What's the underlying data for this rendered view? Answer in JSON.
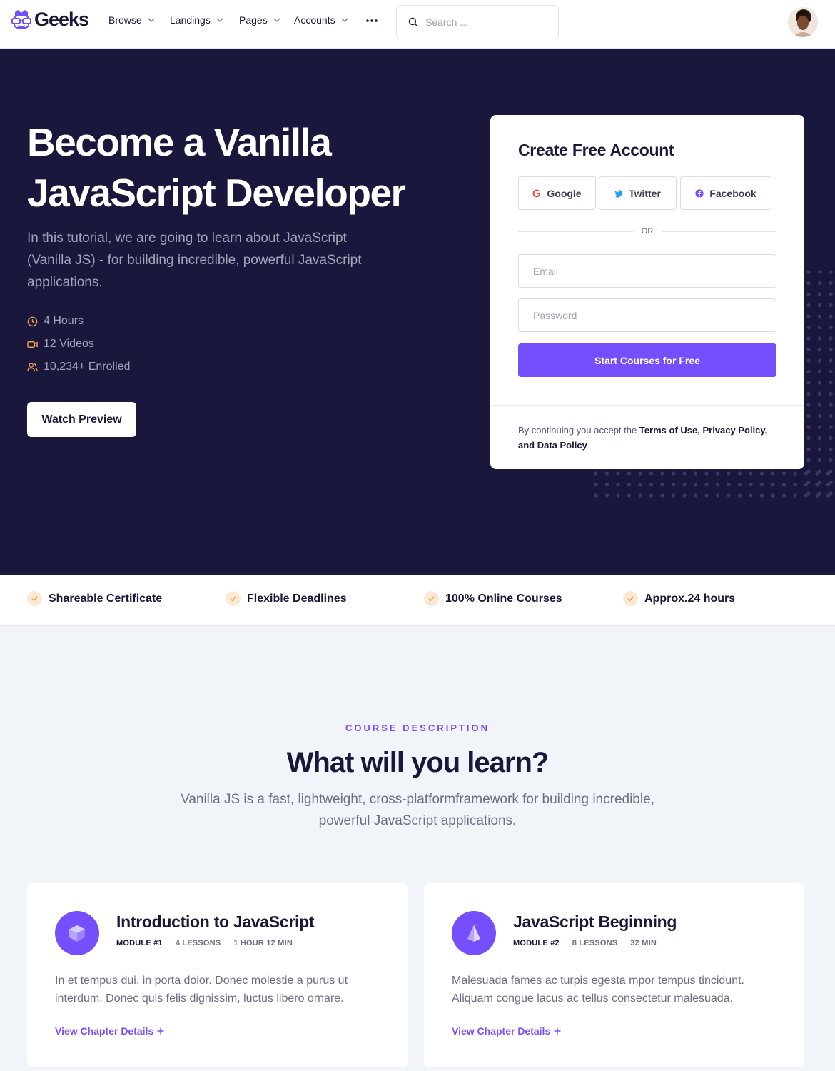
{
  "nav": {
    "brand": "Geeks",
    "items": [
      {
        "label": "Browse"
      },
      {
        "label": "Landings"
      },
      {
        "label": "Pages"
      },
      {
        "label": "Accounts"
      }
    ],
    "more_icon": "more-horizontal-icon",
    "search_placeholder": "Search ..."
  },
  "hero": {
    "title": "Become a Vanilla JavaScript Developer",
    "description": "In this tutorial, we are going to learn about JavaScript (Vanilla JS) - for building incredible, powerful JavaScript applications.",
    "stats": [
      {
        "icon": "clock-icon",
        "label": "4 Hours"
      },
      {
        "icon": "video-icon",
        "label": "12 Videos"
      },
      {
        "icon": "users-icon",
        "label": "10,234+ Enrolled"
      }
    ],
    "watch_label": "Watch Preview",
    "accent": "#f5a24b"
  },
  "form": {
    "title": "Create Free Account",
    "social": [
      {
        "label": "Google",
        "icon": "google-icon",
        "color": "#ea4335"
      },
      {
        "label": "Twitter",
        "icon": "twitter-icon",
        "color": "#1da1f2"
      },
      {
        "label": "Facebook",
        "icon": "facebook-icon",
        "color": "#754ffe"
      }
    ],
    "or": "OR",
    "email_placeholder": "Email",
    "password_placeholder": "Password",
    "submit_label": "Start Courses for Free",
    "terms_prefix": "By continuing you accept the ",
    "terms_strong": "Terms of Use, Privacy Policy, and Data Policy"
  },
  "features": [
    {
      "label": "Shareable Certificate"
    },
    {
      "label": "Flexible Deadlines"
    },
    {
      "label": "100% Online Courses"
    },
    {
      "label": "Approx.24 hours"
    }
  ],
  "description": {
    "eyebrow": "COURSE DESCRIPTION",
    "title": "What will you learn?",
    "subtitle": "Vanilla JS is a fast, lightweight, cross-platformframework for building incredible, powerful JavaScript applications."
  },
  "modules": [
    {
      "title": "Introduction to JavaScript",
      "module": "MODULE #1",
      "lessons": "4 LESSONS",
      "duration": "1 HOUR 12 MIN",
      "text": "In et tempus dui, in porta dolor. Donec molestie a purus ut interdum. Donec quis felis dignissim, luctus libero ornare.",
      "link": "View Chapter Details",
      "icon": "cube-icon"
    },
    {
      "title": "JavaScript Beginning",
      "module": "MODULE #2",
      "lessons": "8 LESSONS",
      "duration": "32 MIN",
      "text": "Malesuada fames ac turpis egesta mpor tempus tincidunt. Aliquam congue lacus ac tellus consectetur malesuada.",
      "link": "View Chapter Details",
      "icon": "pyramid-icon"
    }
  ],
  "colors": {
    "primary": "#754ffe",
    "dark": "#19173c"
  }
}
